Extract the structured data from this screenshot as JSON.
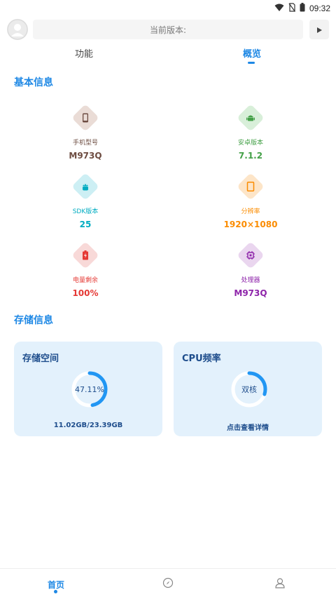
{
  "status_bar": {
    "time": "09:32",
    "icons": [
      "wifi-icon",
      "no-sim-icon",
      "battery-icon"
    ]
  },
  "header": {
    "version_label": "当前版本:",
    "avatar_icon": "user-avatar-icon",
    "play_icon": "play-icon"
  },
  "tabs": [
    {
      "label": "功能"
    },
    {
      "label": "概览"
    }
  ],
  "basic_info": {
    "title": "基本信息",
    "items": [
      {
        "label": "手机型号",
        "value": "M973Q",
        "icon": "phone-icon",
        "color": "#6d4c41",
        "bg": "#eadcd6"
      },
      {
        "label": "安卓版本",
        "value": "7.1.2",
        "icon": "android-icon",
        "color": "#43a047",
        "bg": "#d8efd9"
      },
      {
        "label": "SDK版本",
        "value": "25",
        "icon": "android-sdk-icon",
        "color": "#00acc1",
        "bg": "#cdeff4"
      },
      {
        "label": "分辨率",
        "value": "1920×1080",
        "icon": "screen-icon",
        "color": "#fb8c00",
        "bg": "#fde5c8"
      },
      {
        "label": "电量剩余",
        "value": "100%",
        "icon": "battery-charging-icon",
        "color": "#e53935",
        "bg": "#f8d9d8"
      },
      {
        "label": "处理器",
        "value": "M973Q",
        "icon": "chip-icon",
        "color": "#8e24aa",
        "bg": "#ead6ef"
      }
    ]
  },
  "storage_info": {
    "title": "存储信息",
    "storage_card": {
      "title": "存储空间",
      "percent_text": "47.11%",
      "percent": 0.4711,
      "detail": "11.02GB/23.39GB"
    },
    "cpu_card": {
      "title": "CPU频率",
      "center_text": "双核",
      "level": 0.3,
      "action": "点击查看详情"
    }
  },
  "bottom_nav": [
    {
      "label": "首页",
      "icon": "home-icon",
      "active": true
    },
    {
      "label": "",
      "icon": "compass-icon",
      "active": false
    },
    {
      "label": "",
      "icon": "user-icon",
      "active": false
    }
  ],
  "colors": {
    "accent": "#1e88e5",
    "card_bg": "#e3f1fc",
    "ring": "#2196f3",
    "ring_track": "#ffffff"
  }
}
